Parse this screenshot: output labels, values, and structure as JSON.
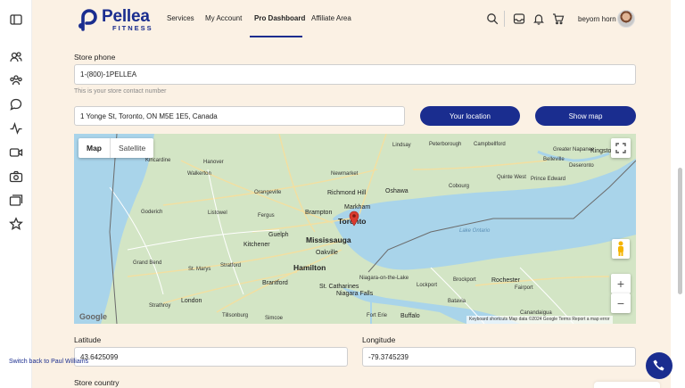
{
  "sidebar": {
    "icons": [
      "dashboard-icon",
      "users-icon",
      "group-icon",
      "chat-icon",
      "activity-icon",
      "video-icon",
      "camera-icon",
      "gallery-icon",
      "star-icon"
    ]
  },
  "brand": {
    "name": "Pellea",
    "sub": "FITNESS"
  },
  "nav": {
    "links": [
      "Services",
      "My Account",
      "Pro Dashboard",
      "Affiliate Area"
    ],
    "active": "Pro Dashboard"
  },
  "header": {
    "username": "beyorn horn"
  },
  "form": {
    "store_phone_label": "Store phone",
    "store_phone_value": "1-(800)-1PELLEA",
    "store_phone_help": "This is your store contact number",
    "address_value": "1 Yonge St, Toronto, ON M5E 1E5, Canada",
    "your_location_label": "Your location",
    "show_map_label": "Show map",
    "latitude_label": "Latitude",
    "latitude_value": "43.6425099",
    "longitude_label": "Longitude",
    "longitude_value": "-79.3745239",
    "store_country_label": "Store country"
  },
  "map": {
    "tab_map": "Map",
    "tab_satellite": "Satellite",
    "google_label": "Google",
    "attribution": "Keyboard shortcuts    Map data ©2024 Google    Terms    Report a map error",
    "lake_label": "Lake Ontario",
    "places": {
      "toronto": "Toronto",
      "mississauga": "Mississauga",
      "hamilton": "Hamilton",
      "oakville": "Oakville",
      "brampton": "Brampton",
      "markham": "Markham",
      "richmond_hill": "Richmond Hill",
      "oshawa": "Oshawa",
      "newmarket": "Newmarket",
      "kitchener": "Kitchener",
      "guelph": "Guelph",
      "brantford": "Brantford",
      "london": "London",
      "st_catharines": "St. Catharines",
      "niagara_falls": "Niagara Falls",
      "buffalo": "Buffalo",
      "rochester": "Rochester",
      "kingston": "Kingston",
      "peterborough": "Peterborough",
      "orangeville": "Orangeville",
      "cobourg": "Cobourg",
      "quinte_west": "Quinte West",
      "belleville": "Belleville",
      "prince_edward": "Prince Edward",
      "stratford": "Stratford",
      "goderich": "Goderich",
      "fergus": "Fergus",
      "listowel": "Listowel",
      "grand_bend": "Grand Bend",
      "st_marys": "St. Marys",
      "walkerton": "Walkerton",
      "hanover": "Hanover",
      "kincardine": "Kincardine",
      "tillsonburg": "Tillsonburg",
      "simcoe": "Simcoe",
      "batavia": "Batavia",
      "lockport": "Lockport",
      "brockport": "Brockport",
      "fairport": "Fairport",
      "canandaigua": "Canandaigua",
      "niagara_on_the_lake": "Niagara-on-the-Lake",
      "fort_erie": "Fort Erie",
      "campbellford": "Campbellford",
      "lindsay": "Lindsay",
      "greater_napanee": "Greater Napanee",
      "deseronto": "Deseronto",
      "strathroy": "Strathroy"
    }
  },
  "footer": {
    "switch_back": "Switch back to Paul Williams"
  }
}
